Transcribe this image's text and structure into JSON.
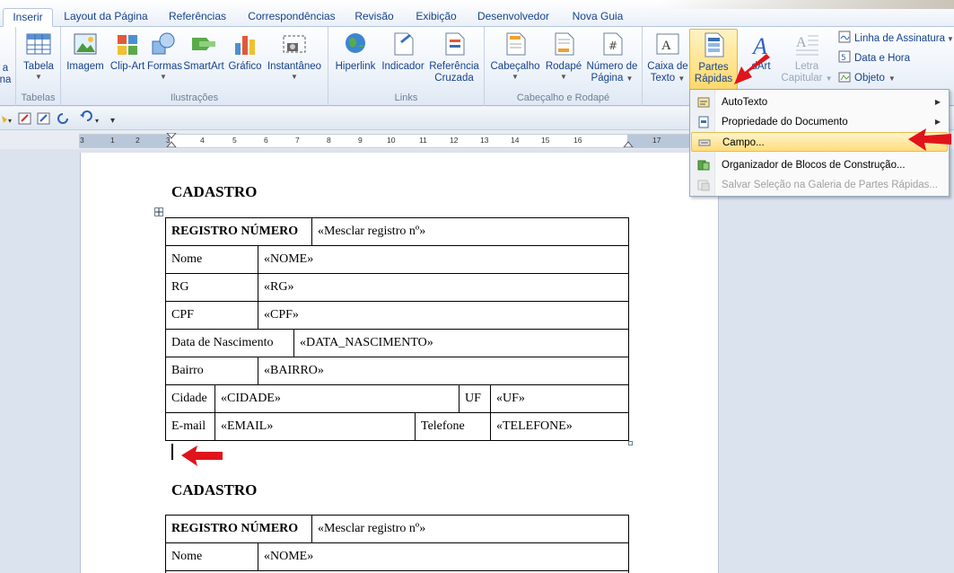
{
  "tabs": [
    {
      "label": "Inserir",
      "active": true
    },
    {
      "label": "Layout da Página"
    },
    {
      "label": "Referências"
    },
    {
      "label": "Correspondências"
    },
    {
      "label": "Revisão"
    },
    {
      "label": "Exibição"
    },
    {
      "label": "Desenvolvedor"
    },
    {
      "label": "Nova Guia"
    }
  ],
  "ribbon": {
    "partial_left": {
      "line1": "a",
      "line2": "na"
    },
    "tabelas": {
      "button": "Tabela",
      "group": "Tabelas"
    },
    "ilustracoes": {
      "buttons": [
        "Imagem",
        "Clip-Art",
        "Formas",
        "SmartArt",
        "Gráfico",
        "Instantâneo"
      ],
      "group": "Ilustrações"
    },
    "links": {
      "buttons": [
        "Hiperlink",
        "Indicador",
        "Referência",
        "Cruzada"
      ],
      "group": "Links"
    },
    "cabecalho": {
      "buttons": [
        "Cabeçalho",
        "Rodapé",
        "Número de",
        "Página"
      ],
      "group": "Cabeçalho e Rodapé"
    },
    "texto": {
      "caixa": [
        "Caixa de",
        "Texto"
      ],
      "partes": [
        "Partes",
        "Rápidas"
      ],
      "wordart": "dArt",
      "letra": [
        "Letra",
        "Capitular"
      ],
      "small": [
        "Linha de Assinatura",
        "Data e Hora",
        "Objeto"
      ]
    }
  },
  "ruler": {
    "numbers": [
      "3",
      "1",
      "2",
      "3",
      "4",
      "5",
      "6",
      "7",
      "8",
      "9",
      "10",
      "11",
      "12",
      "13",
      "14",
      "15",
      "16",
      "17"
    ]
  },
  "menu": {
    "items": [
      {
        "label": "AutoTexto",
        "submenu": true
      },
      {
        "label": "Propriedade do Documento",
        "submenu": true
      },
      {
        "label": "Campo...",
        "highlighted": true
      },
      {
        "label": "Organizador de Blocos de Construção..."
      },
      {
        "label": "Salvar Seleção na Galeria de Partes Rápidas...",
        "disabled": true
      }
    ]
  },
  "document": {
    "heading1": "CADASTRO",
    "heading2": "CADASTRO",
    "table1": {
      "rows": [
        [
          "REGISTRO NÚMERO",
          "«Mesclar registro nº»"
        ],
        [
          "Nome",
          "«NOME»"
        ],
        [
          "RG",
          "«RG»"
        ],
        [
          "CPF",
          "«CPF»"
        ],
        [
          "Data de Nascimento",
          "«DATA_NASCIMENTO»"
        ],
        [
          "Bairro",
          "«BAIRRO»"
        ],
        [
          "Cidade",
          "«CIDADE»",
          "UF",
          "«UF»"
        ],
        [
          "E-mail",
          "«EMAIL»",
          "Telefone",
          "«TELEFONE»"
        ]
      ]
    },
    "table2": {
      "rows": [
        [
          "REGISTRO NÚMERO",
          "«Mesclar registro nº»"
        ],
        [
          "Nome",
          "«NOME»"
        ]
      ]
    }
  },
  "colors": {
    "accent": "#15428b",
    "highlight": "#ffdc7c",
    "arrow": "#e0141b"
  }
}
